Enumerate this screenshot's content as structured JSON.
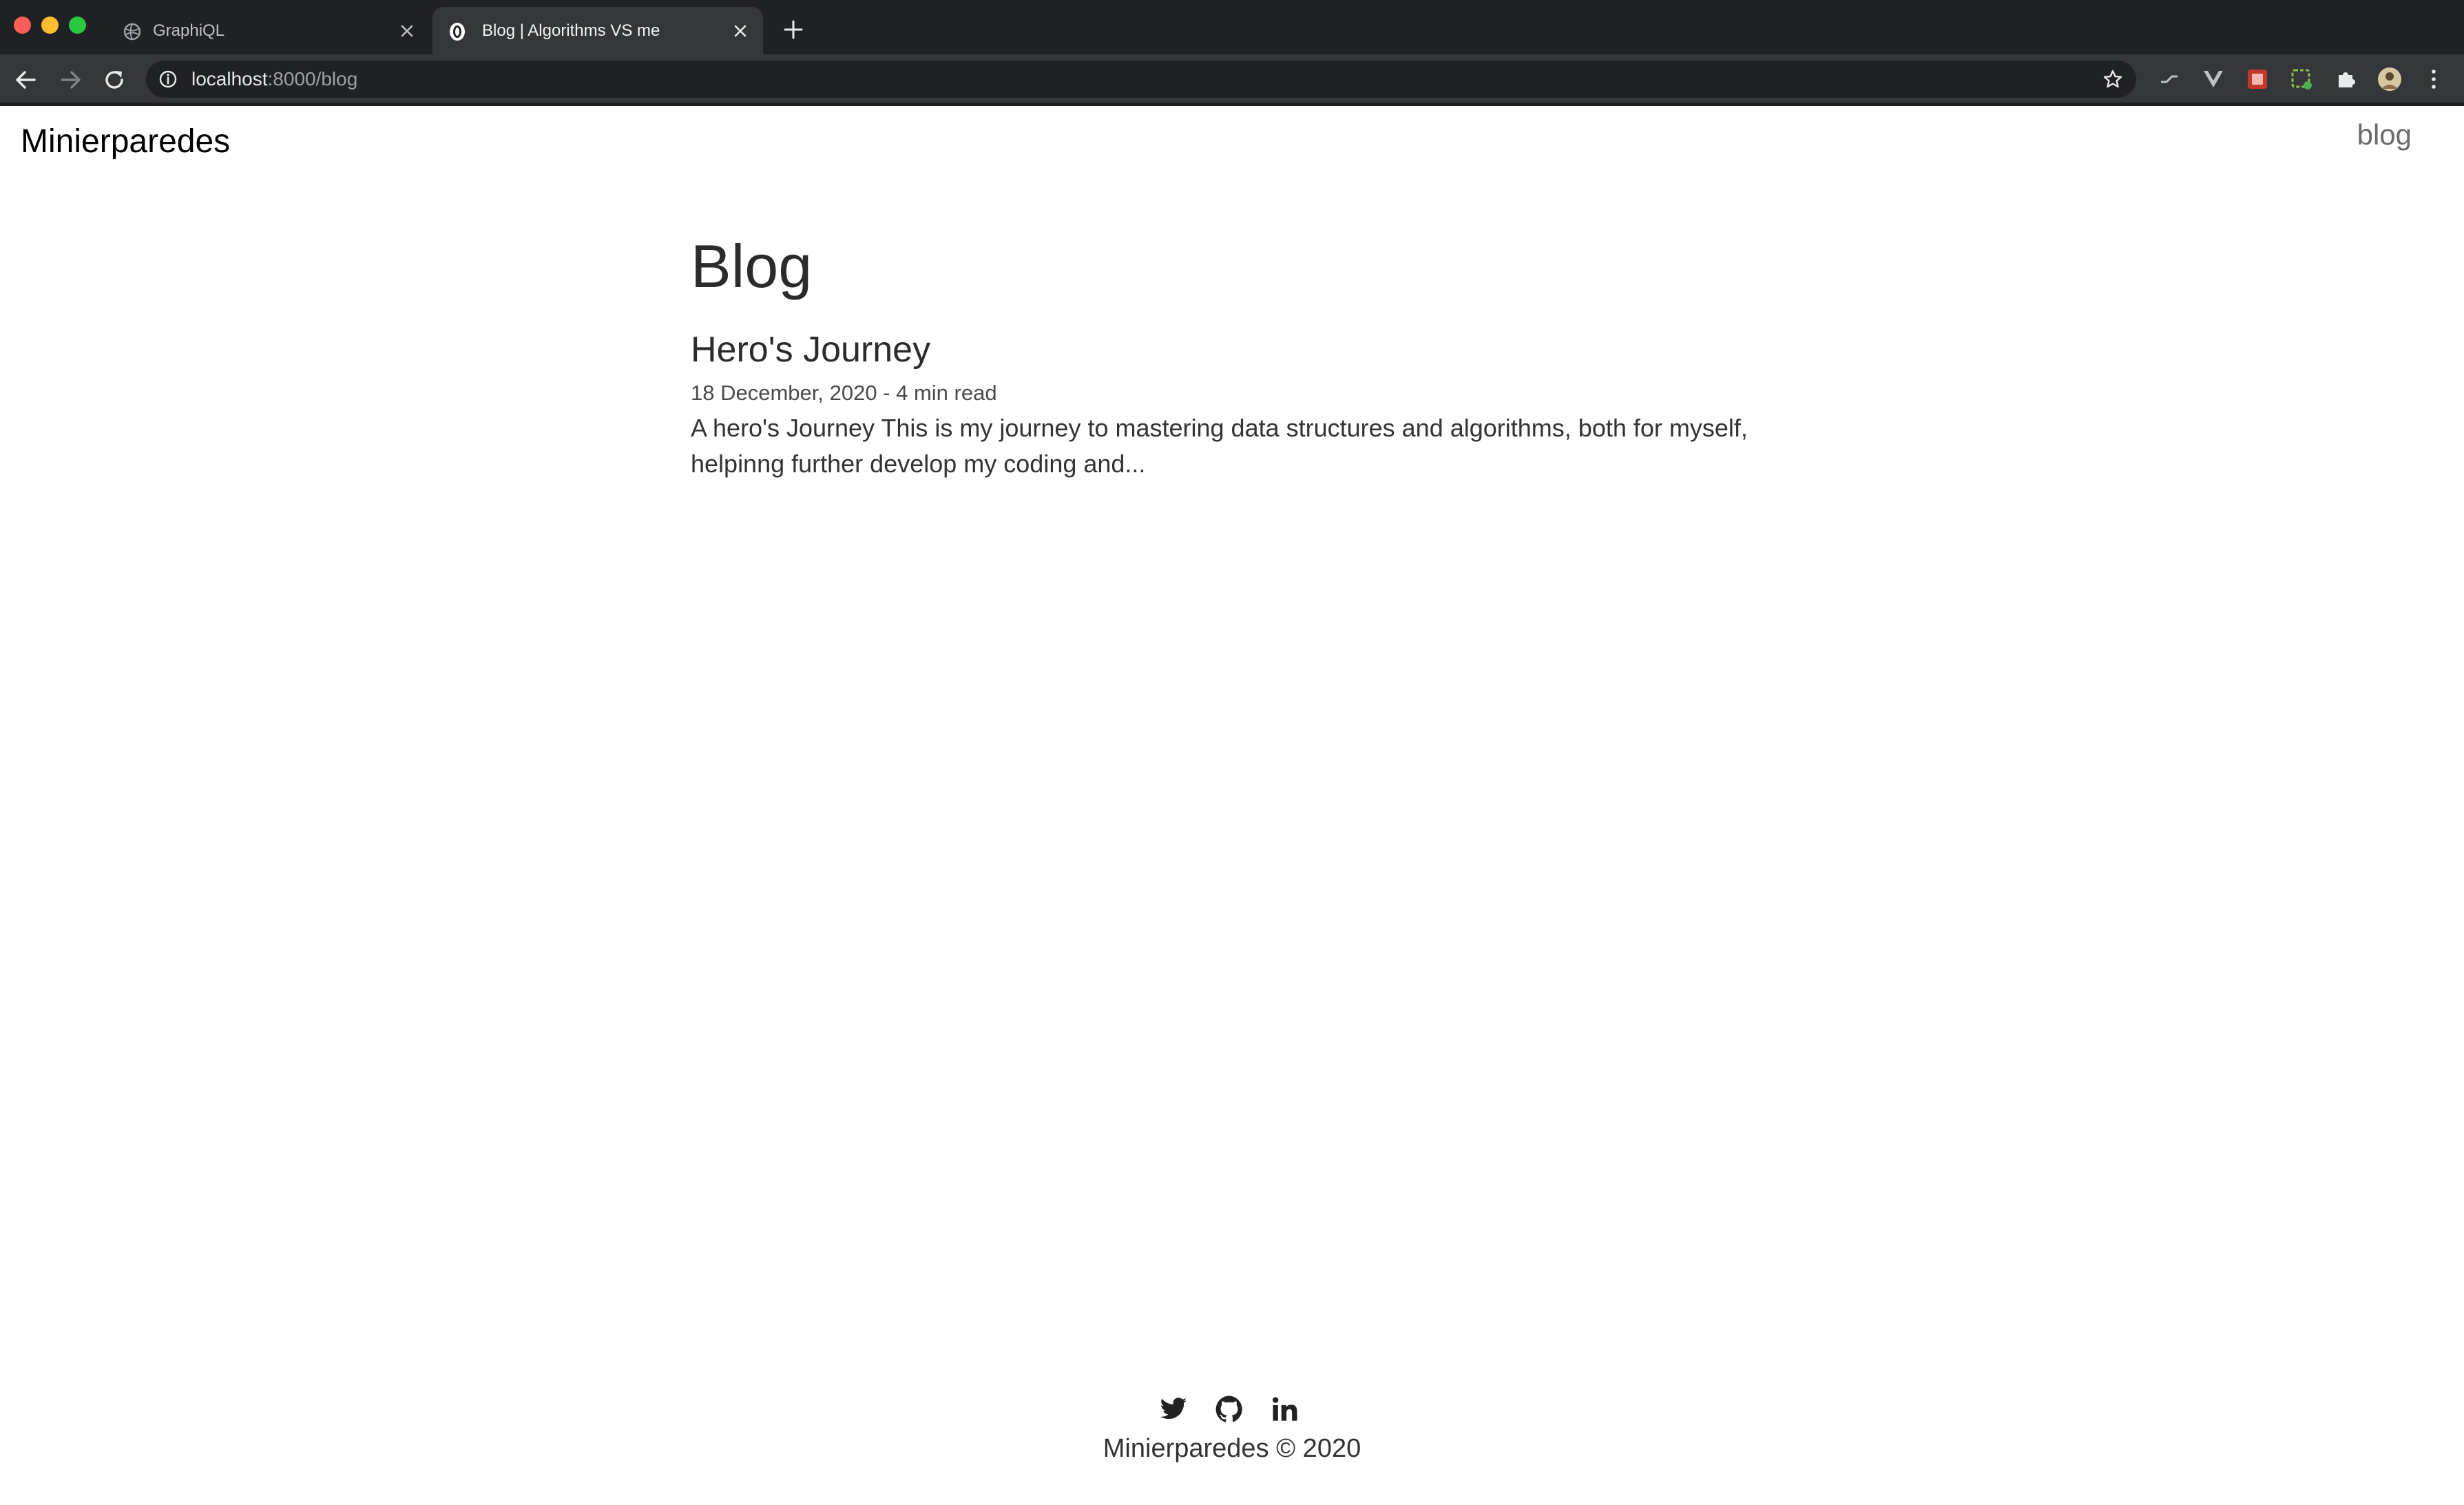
{
  "browser": {
    "tabs": [
      {
        "title": "GraphiQL",
        "active": false
      },
      {
        "title": "Blog | Algorithms VS me",
        "active": true
      }
    ],
    "url_host": "localhost",
    "url_path": ":8000/blog"
  },
  "site": {
    "title": "Minierparedes",
    "nav": {
      "blog_label": "blog"
    }
  },
  "main": {
    "heading": "Blog",
    "posts": [
      {
        "title": "Hero's Journey",
        "meta": "18 December, 2020 - 4 min read",
        "excerpt": "A hero's Journey This is my journey to mastering data structures and algorithms, both for myself, helpinng further develop my coding and..."
      }
    ]
  },
  "footer": {
    "copyright": "Minierparedes © 2020",
    "icons": [
      "twitter-icon",
      "github-icon",
      "linkedin-icon"
    ]
  },
  "colors": {
    "chrome_dark": "#202124",
    "chrome_toolbar": "#35363a",
    "text_primary": "#2b2b2b",
    "nav_text": "#6b6b6b"
  }
}
